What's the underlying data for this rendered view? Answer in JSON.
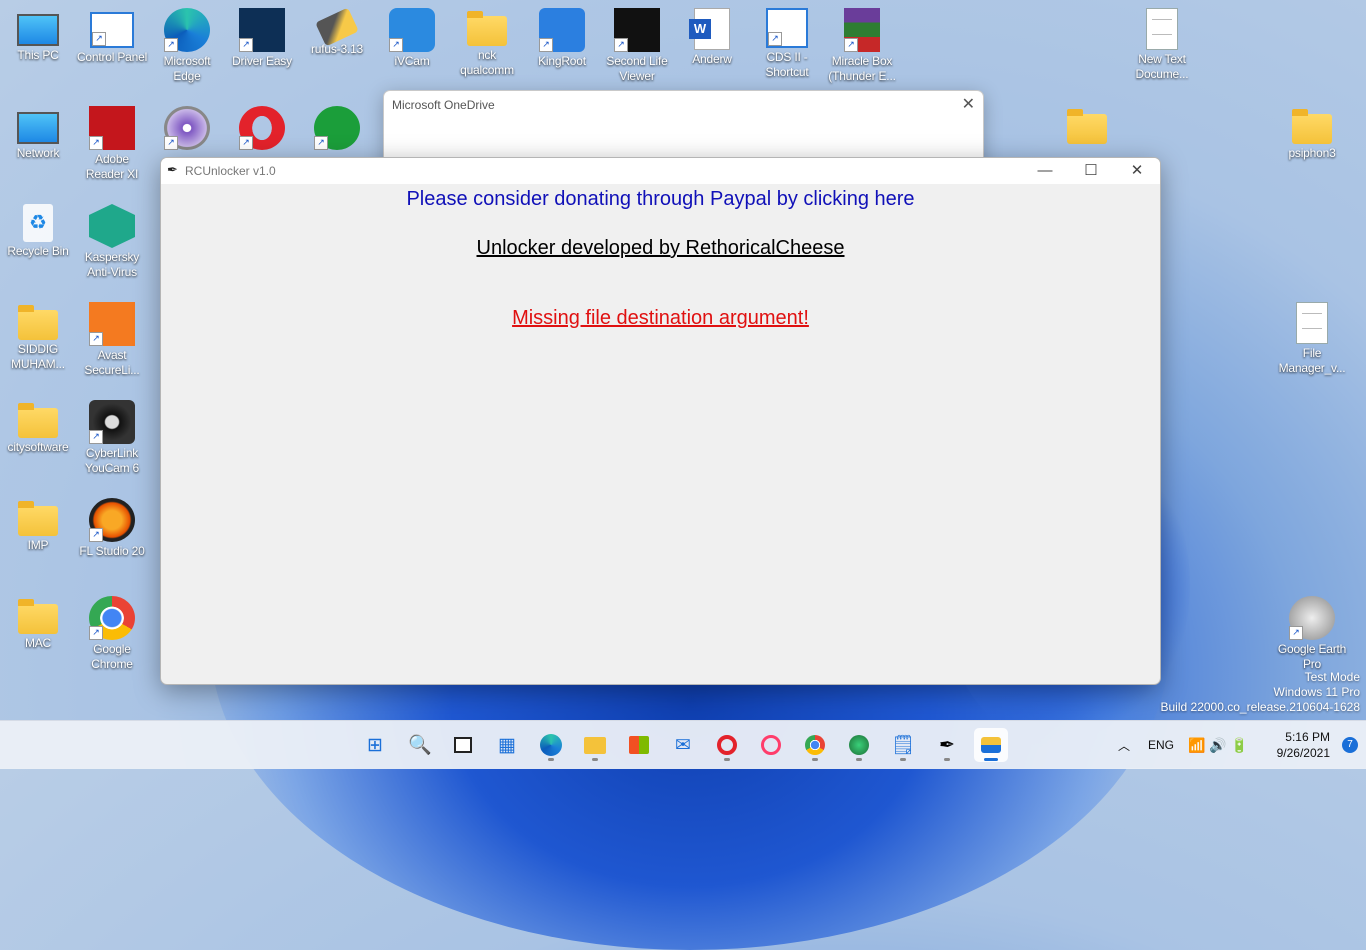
{
  "desktop": {
    "icons": [
      {
        "label": "This PC"
      },
      {
        "label": "Control Panel"
      },
      {
        "label": "Microsoft Edge"
      },
      {
        "label": "Driver Easy"
      },
      {
        "label": "rufus-3.13"
      },
      {
        "label": "iVCam"
      },
      {
        "label": "nck qualcomm"
      },
      {
        "label": "KingRoot"
      },
      {
        "label": "Second Life Viewer"
      },
      {
        "label": "Anderw"
      },
      {
        "label": "CDS II - Shortcut"
      },
      {
        "label": "Miracle Box (Thunder E..."
      },
      {
        "label": "New Text Docume..."
      },
      {
        "label": "Network"
      },
      {
        "label": "Adobe Reader XI"
      },
      {
        "label": "psiphon3"
      },
      {
        "label": "Recycle Bin"
      },
      {
        "label": "Kaspersky Anti-Virus"
      },
      {
        "label": "SIDDIG MUHAM..."
      },
      {
        "label": "Avast SecureLi..."
      },
      {
        "label": "File Manager_v..."
      },
      {
        "label": "citysoftware"
      },
      {
        "label": "CyberLink YouCam 6"
      },
      {
        "label": "IMP"
      },
      {
        "label": "FL Studio 20"
      },
      {
        "label": "MAC"
      },
      {
        "label": "Google Chrome"
      },
      {
        "label": "Google Earth Pro"
      }
    ]
  },
  "onedrive": {
    "title": "Microsoft OneDrive",
    "close": "✕"
  },
  "window": {
    "title": "RCUnlocker v1.0",
    "minimize": "—",
    "maximize": "☐",
    "close": "✕",
    "donate_text": "Please consider donating through Paypal by clicking here",
    "credit_text": "Unlocker developed by RethoricalCheese",
    "error_text": "Missing file destination argument!"
  },
  "watermark": {
    "line1": "Test Mode",
    "line2": "Windows 11 Pro",
    "line3": "Build 22000.co_release.210604-1628"
  },
  "taskbar": {
    "language": "ENG",
    "time": "5:16 PM",
    "date": "9/26/2021",
    "notifications": "7"
  },
  "colors": {
    "donate": "#1010b8",
    "error": "#e01010",
    "accent": "#1a6fd8"
  }
}
